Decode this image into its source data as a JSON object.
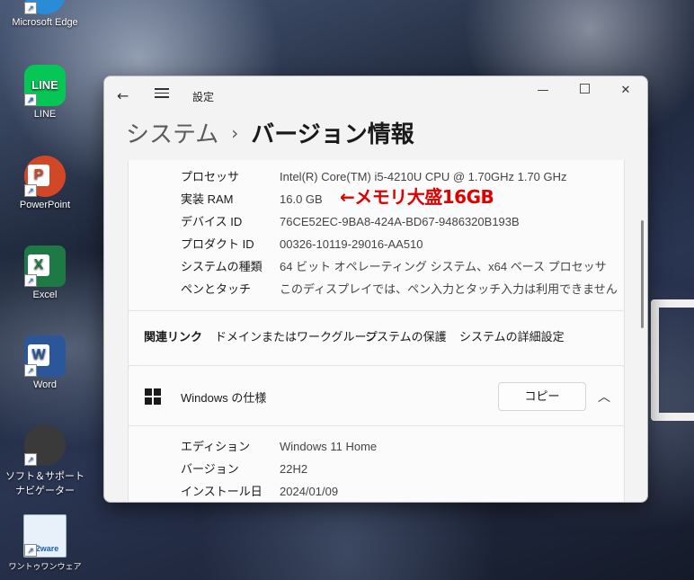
{
  "desktop": {
    "icons": [
      {
        "label": "Microsoft Edge",
        "icon": "edge-icon"
      },
      {
        "label": "LINE",
        "icon": "line-icon"
      },
      {
        "label": "PowerPoint",
        "icon": "powerpoint-icon"
      },
      {
        "label": "Excel",
        "icon": "excel-icon"
      },
      {
        "label": "Word",
        "icon": "word-icon"
      },
      {
        "label": "ソフト＆サポートナビゲーター",
        "icon": "soft-support-navi-icon"
      },
      {
        "label": "ワントゥワンウェア",
        "icon": "12ware-icon"
      }
    ],
    "line_text": "LINE",
    "ppt_letter": "P",
    "excel_letter": "X",
    "word_letter": "W",
    "ware_text": "12ware"
  },
  "window": {
    "title": "設定",
    "breadcrumb": {
      "parent": "システム",
      "separator": "›",
      "current": "バージョン情報"
    }
  },
  "device_specs": [
    {
      "label": "プロセッサ",
      "value": "Intel(R) Core(TM) i5-4210U CPU @ 1.70GHz   1.70 GHz"
    },
    {
      "label": "実装 RAM",
      "value": "16.0 GB"
    },
    {
      "label": "デバイス ID",
      "value": "76CE52EC-9BA8-424A-BD67-9486320B193B"
    },
    {
      "label": "プロダクト ID",
      "value": "00326-10119-29016-AA510"
    },
    {
      "label": "システムの種類",
      "value": "64 ビット オペレーティング システム、x64 ベース プロセッサ"
    },
    {
      "label": "ペンとタッチ",
      "value": "このディスプレイでは、ペン入力とタッチ入力は利用できません"
    }
  ],
  "related_links": {
    "label": "関連リンク",
    "links": [
      "ドメインまたはワークグループ",
      "システムの保護",
      "システムの詳細設定"
    ]
  },
  "windows_spec": {
    "title": "Windows の仕様",
    "copy_label": "コピー",
    "rows": [
      {
        "label": "エディション",
        "value": "Windows 11 Home"
      },
      {
        "label": "バージョン",
        "value": "22H2"
      },
      {
        "label": "インストール日",
        "value": "2024/01/09"
      }
    ]
  },
  "annotation": "←メモリ大盛16GB"
}
